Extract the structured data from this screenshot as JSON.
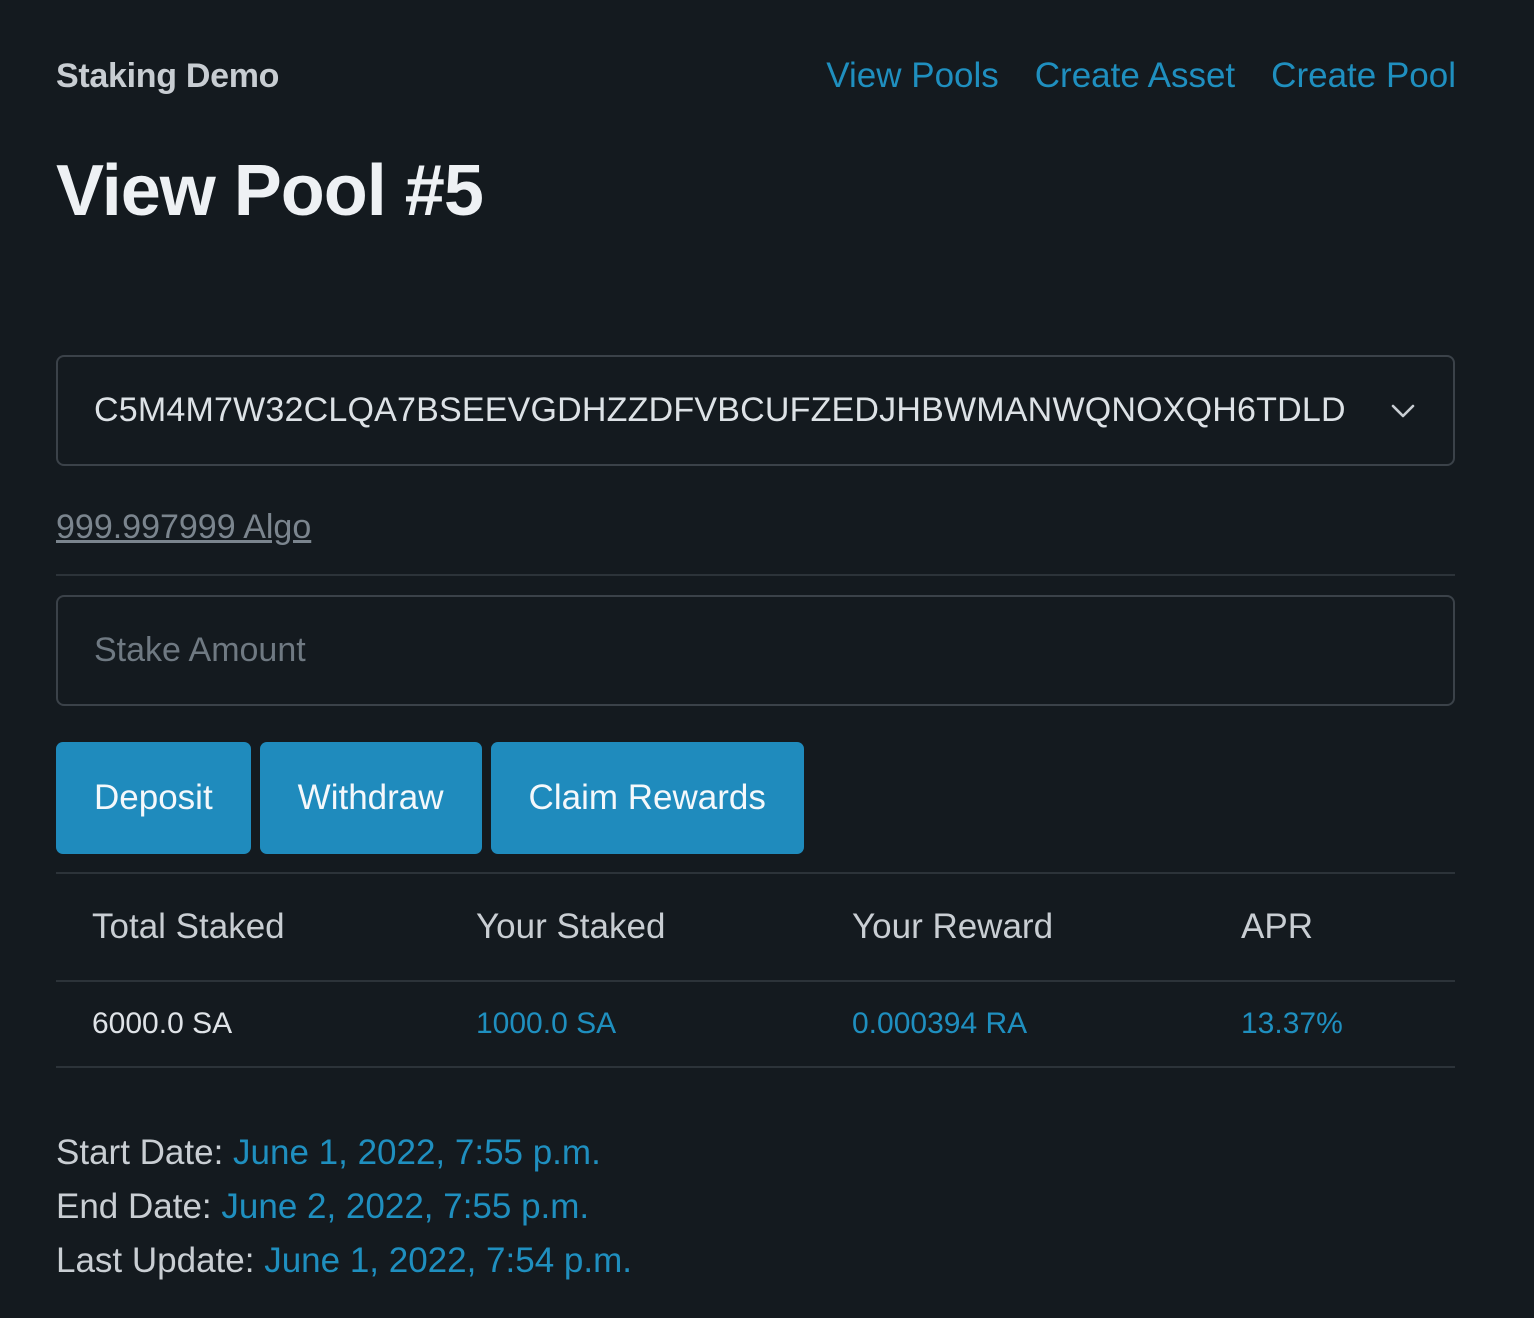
{
  "brand": "Staking Demo",
  "nav": {
    "links": [
      "View Pools",
      "Create Asset",
      "Create Pool"
    ]
  },
  "page_title": "View Pool #5",
  "account_select": {
    "value": "C5M4M7W32CLQA7BSEEVGDHZZDFVBCUFZEDJHBWMANWQNOXQH6TDLD"
  },
  "balance": "999.997999 Algo",
  "stake_input": {
    "placeholder": "Stake Amount",
    "value": ""
  },
  "buttons": {
    "deposit": "Deposit",
    "withdraw": "Withdraw",
    "claim": "Claim Rewards"
  },
  "stats": {
    "headers": [
      "Total Staked",
      "Your Staked",
      "Your Reward",
      "APR"
    ],
    "values": [
      "6000.0 SA",
      "1000.0 SA",
      "0.000394 RA",
      "13.37%"
    ]
  },
  "dates": {
    "start_label": "Start Date:",
    "start_value": "June 1, 2022, 7:55 p.m.",
    "end_label": "End Date:",
    "end_value": "June 2, 2022, 7:55 p.m.",
    "update_label": "Last Update:",
    "update_value": "June 1, 2022, 7:54 p.m."
  },
  "colors": {
    "background": "#141a1f",
    "accent": "#1f8bbd",
    "link": "#1f8fbf",
    "border": "#3b4249"
  },
  "icons": {
    "select_chevron": "chevron-down-icon"
  }
}
